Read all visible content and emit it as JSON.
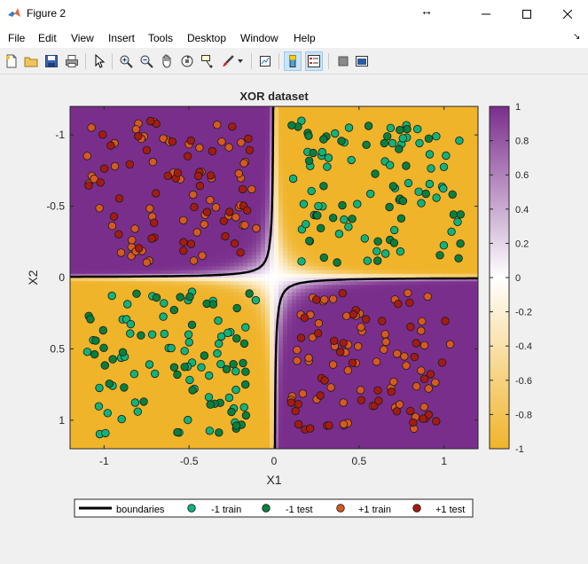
{
  "window": {
    "title": "Figure 2"
  },
  "menu": [
    "File",
    "Edit",
    "View",
    "Insert",
    "Tools",
    "Desktop",
    "Window",
    "Help"
  ],
  "toolbar": [
    "new-figure",
    "open-file",
    "save",
    "print",
    "pointer",
    "zoom-in",
    "zoom-out",
    "pan",
    "rotate-3d",
    "data-cursor",
    "brush",
    "link-plot",
    "insert-colorbar",
    "insert-legend",
    "hide-plot-tools",
    "show-plot-tools"
  ],
  "chart_data": {
    "type": "scatter",
    "title": "XOR dataset",
    "xlabel": "X1",
    "ylabel": "X2",
    "xlim": [
      -1.2,
      1.2
    ],
    "ylim": [
      -1.2,
      1.2
    ],
    "y_reversed": true,
    "xticks": [
      "-1",
      "-0.5",
      "0",
      "0.5",
      "1"
    ],
    "yticks": [
      "-1",
      "-0.5",
      "0",
      "0.5",
      "1"
    ],
    "background": "decision function heatmap: +1 (purple) where X1*X2 > 0, -1 (orange) where X1*X2 < 0",
    "colorbar": {
      "range": [
        -1,
        1
      ],
      "ticks": [
        "1",
        "0.8",
        "0.6",
        "0.4",
        "0.2",
        "0",
        "-0.2",
        "-0.4",
        "-0.6",
        "-0.8",
        "-1"
      ],
      "colors": {
        "low": "#f0b42a",
        "mid": "#ffffff",
        "high": "#7a2e8c"
      }
    },
    "series": [
      {
        "name": "boundaries",
        "kind": "line",
        "color": "#000000"
      },
      {
        "name": "-1 train",
        "kind": "marker",
        "color": "#10b47a",
        "quadrants": [
          "x<0,y>0",
          "x>0,y<0"
        ],
        "n_per_quadrant": 60
      },
      {
        "name": "-1 test",
        "kind": "marker",
        "color": "#07803e",
        "quadrants": [
          "x<0,y>0",
          "x>0,y<0"
        ],
        "n_per_quadrant": 45
      },
      {
        "name": "+1 train",
        "kind": "marker",
        "color": "#d65a1e",
        "quadrants": [
          "x<0,y<0",
          "x>0,y>0"
        ],
        "n_per_quadrant": 60
      },
      {
        "name": "+1 test",
        "kind": "marker",
        "color": "#a41b10",
        "quadrants": [
          "x<0,y<0",
          "x>0,y>0"
        ],
        "n_per_quadrant": 45
      }
    ],
    "legend": {
      "placement": "bottom-outside",
      "orientation": "horizontal"
    }
  }
}
